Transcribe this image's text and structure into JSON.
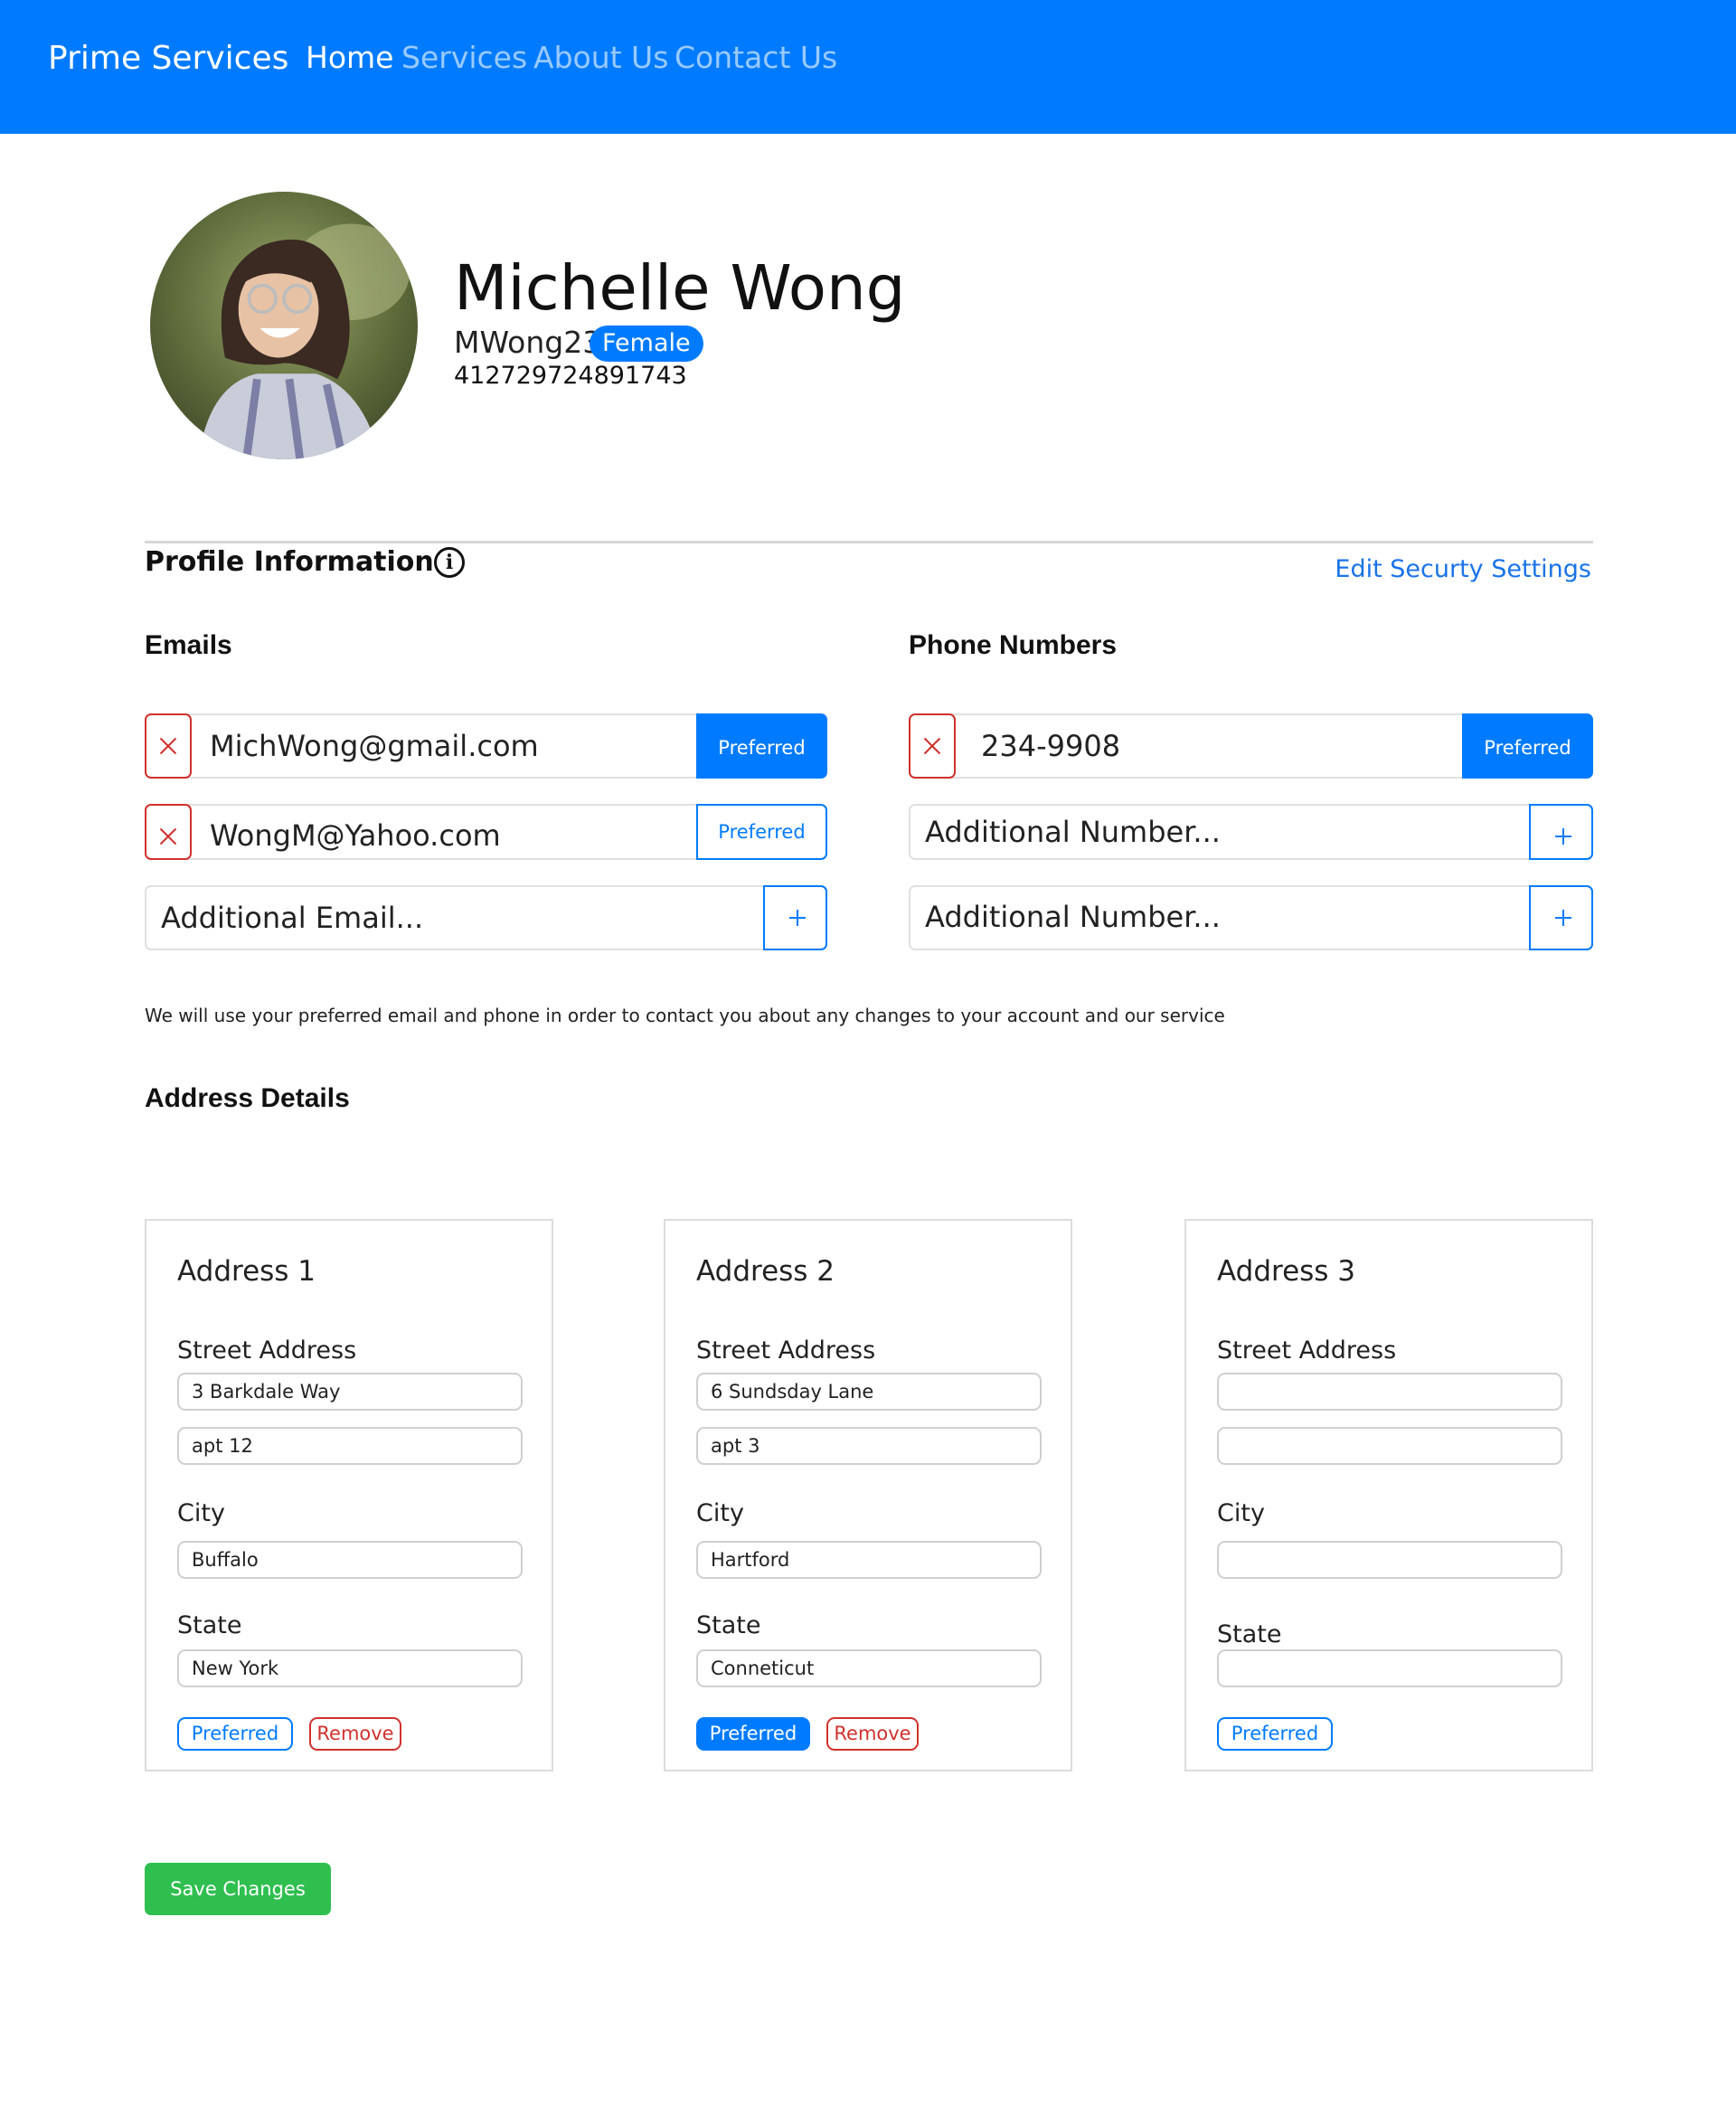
{
  "nav": {
    "brand": "Prime Services",
    "links": [
      "Home",
      "Services",
      "About Us",
      "Contact Us"
    ]
  },
  "profile": {
    "full_name": "Michelle Wong",
    "username": "MWong23",
    "gender": "Female",
    "user_id": "412729724891743"
  },
  "section": {
    "title": "Profile Information",
    "edit_security": "Edit Securty Settings"
  },
  "emails": {
    "title": "Emails",
    "items": [
      {
        "value": "MichWong@gmail.com",
        "preferred_label": "Preferred",
        "preferred": true
      },
      {
        "value": "WongM@Yahoo.com",
        "preferred_label": "Preferred",
        "preferred": false
      }
    ],
    "additional_placeholder": "Additional Email..."
  },
  "phones": {
    "title": "Phone Numbers",
    "items": [
      {
        "value": "234-9908",
        "preferred_label": "Preferred",
        "preferred": true
      }
    ],
    "additional_placeholder": "Additional Number..."
  },
  "note": "We will use your preferred email and phone in order to contact you about any changes to your account and our service",
  "address_section": {
    "title": "Address Details",
    "labels": {
      "street": "Street Address",
      "city": "City",
      "state": "State"
    },
    "cards": [
      {
        "title": "Address 1",
        "street1": "3 Barkdale Way",
        "street2": "apt 12",
        "city": "Buffalo",
        "state": "New York",
        "preferred_label": "Preferred",
        "remove_label": "Remove",
        "preferred": false
      },
      {
        "title": "Address 2",
        "street1": "6 Sundsday Lane",
        "street2": "apt 3",
        "city": "Hartford",
        "state": "Conneticut",
        "preferred_label": "Preferred",
        "remove_label": "Remove",
        "preferred": true
      },
      {
        "title": "Address 3",
        "street1": "",
        "street2": "",
        "city": "",
        "state": "",
        "preferred_label": "Preferred",
        "preferred": false
      }
    ]
  },
  "save_label": "Save Changes",
  "icons": {
    "avatar": "profile-photo",
    "info": "info-icon",
    "delete": "close-icon",
    "add": "plus-icon"
  },
  "colors": {
    "primary": "#007bff",
    "danger": "#d0312d",
    "success": "#2fbf4f"
  }
}
